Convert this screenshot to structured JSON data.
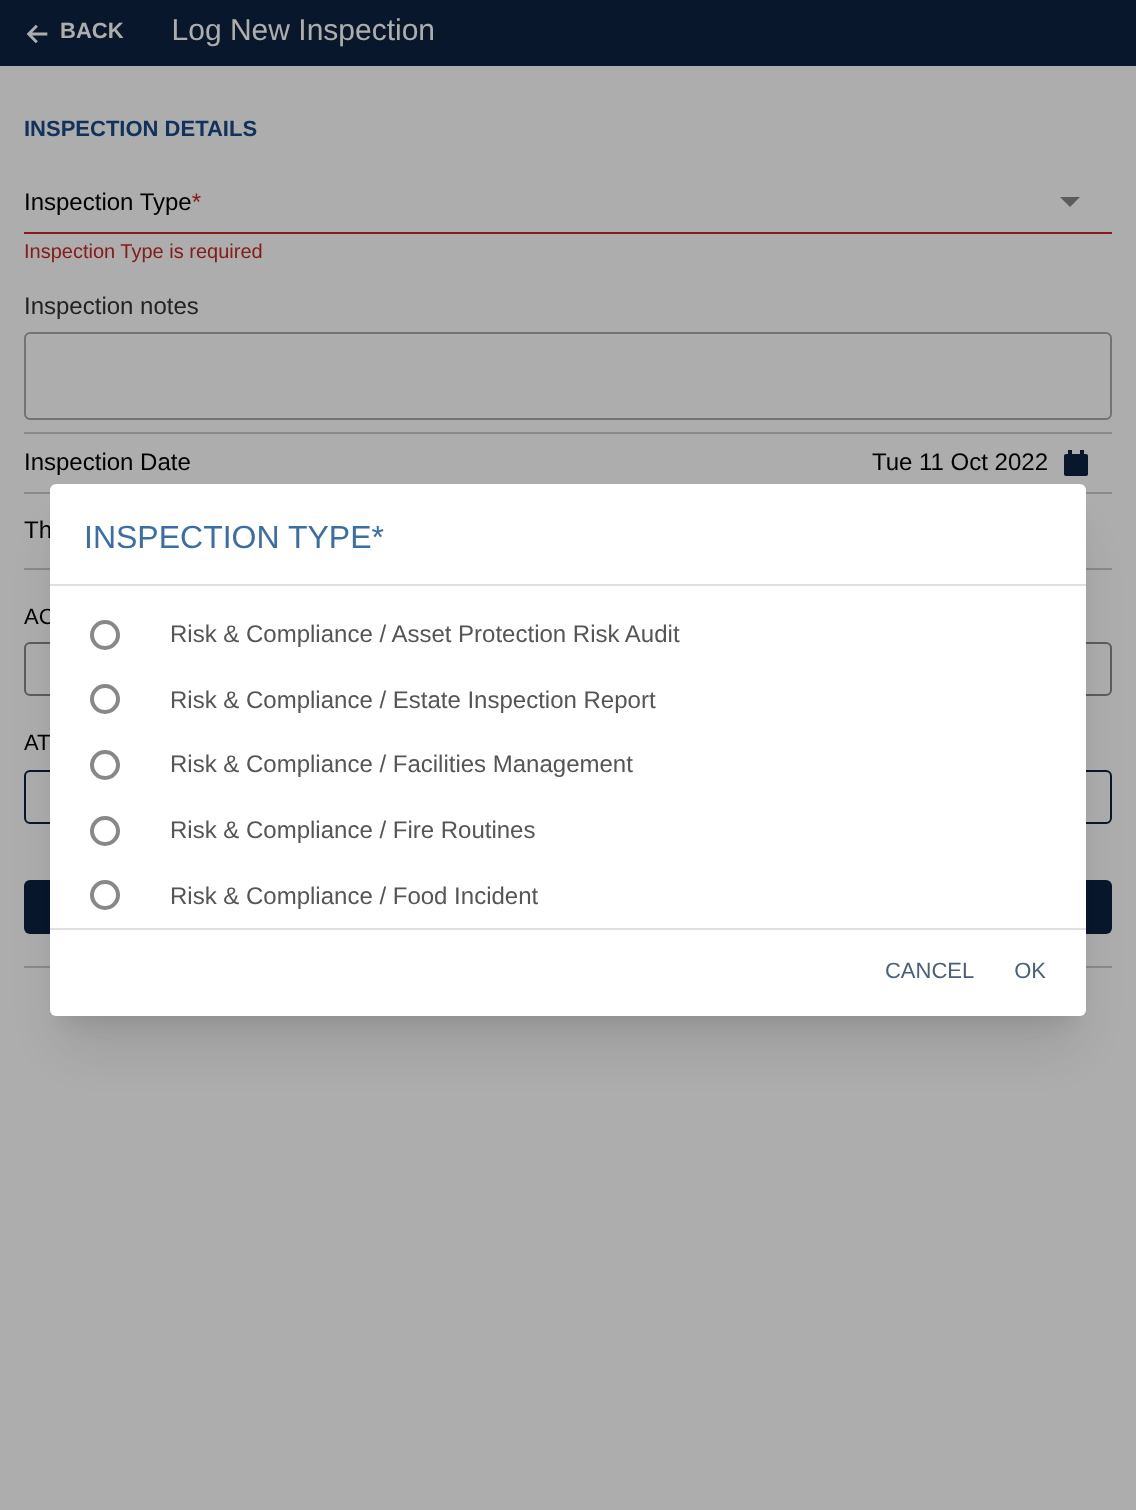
{
  "header": {
    "back": "BACK",
    "title": "Log New Inspection"
  },
  "form": {
    "section": "INSPECTION DETAILS",
    "type_field": {
      "label": "Inspection Type",
      "required_mark": "*",
      "error": "Inspection Type is required"
    },
    "notes": {
      "label": "Inspection notes"
    },
    "date": {
      "label": "Inspection Date",
      "value": "Tue 11 Oct 2022"
    },
    "row_3": {
      "label": "Th"
    },
    "field_4": {
      "label": "AC"
    },
    "field_5": {
      "label": "AT"
    }
  },
  "dialog": {
    "title": "INSPECTION TYPE*",
    "options": [
      {
        "label": "Risk & Compliance / Asset Protection Risk Audit",
        "selected": false
      },
      {
        "label": "Risk & Compliance / Estate Inspection Report",
        "selected": false
      },
      {
        "label": "Risk & Compliance / Facilities Management",
        "selected": false
      },
      {
        "label": "Risk & Compliance / Fire Routines",
        "selected": false
      },
      {
        "label": "Risk & Compliance / Food Incident",
        "selected": false
      }
    ],
    "buttons": [
      "CANCEL",
      "OK"
    ]
  }
}
